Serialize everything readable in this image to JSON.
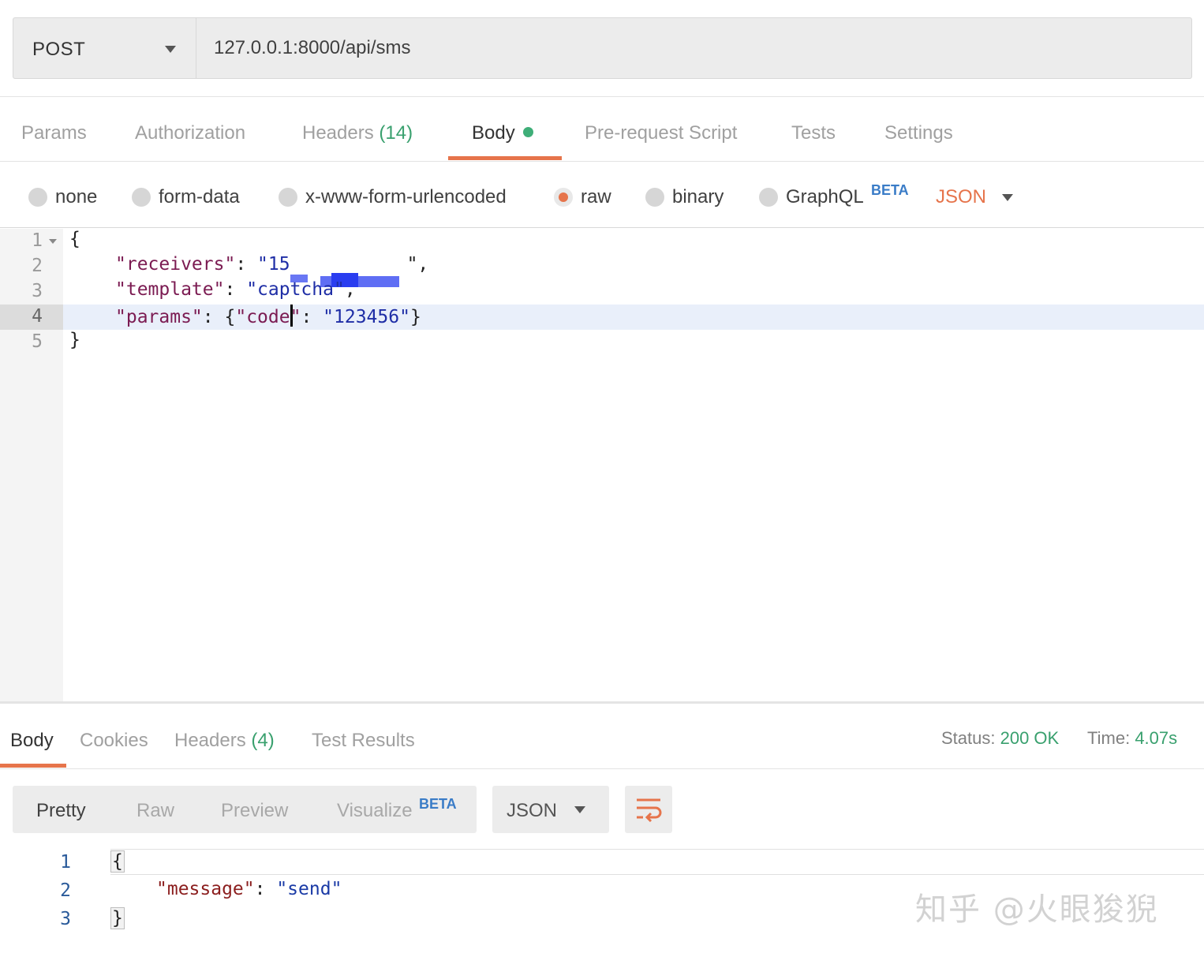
{
  "request": {
    "method": "POST",
    "url": "127.0.0.1:8000/api/sms"
  },
  "request_tabs": {
    "params": "Params",
    "authorization": "Authorization",
    "headers": "Headers",
    "headers_count": "(14)",
    "body": "Body",
    "prerequest": "Pre-request Script",
    "tests": "Tests",
    "settings": "Settings"
  },
  "body_types": {
    "none": "none",
    "form_data": "form-data",
    "urlencoded": "x-www-form-urlencoded",
    "raw": "raw",
    "binary": "binary",
    "graphql": "GraphQL",
    "graphql_badge": "BETA",
    "format": "JSON",
    "selected": "raw"
  },
  "editor": {
    "line_numbers": [
      "1",
      "2",
      "3",
      "4",
      "5"
    ],
    "active_line": "4",
    "l1": "{",
    "receivers_key": "\"receivers\"",
    "receivers_value_visible": "\"15",
    "receivers_value_tail": "\",",
    "template_key": "\"template\"",
    "template_value": "\"captcha\"",
    "params_key": "\"params\"",
    "params_open": "{",
    "code_key_a": "\"code",
    "code_key_b": "\"",
    "code_value": "\"123456\"",
    "params_close": "}",
    "l5": "}",
    "colon": ": ",
    "comma": ","
  },
  "response_tabs": {
    "body": "Body",
    "cookies": "Cookies",
    "headers": "Headers",
    "headers_count": "(4)",
    "test_results": "Test Results"
  },
  "response_status": {
    "status_label": "Status:",
    "status_value": "200 OK",
    "time_label": "Time:",
    "time_value": "4.07s"
  },
  "response_view": {
    "pretty": "Pretty",
    "raw": "Raw",
    "preview": "Preview",
    "visualize": "Visualize",
    "visualize_badge": "BETA",
    "format": "JSON"
  },
  "response_body": {
    "line_numbers": [
      "1",
      "2",
      "3"
    ],
    "open": "{",
    "message_key": "\"message\"",
    "colon": ": ",
    "message_value": "\"send\"",
    "close": "}"
  },
  "watermark": "知乎 @火眼狻猊",
  "colors": {
    "accent": "#e6744b",
    "success": "#39a06e",
    "beta": "#3a7cc7",
    "json_key": "#7b1b52",
    "json_string": "#1f2ea6"
  }
}
